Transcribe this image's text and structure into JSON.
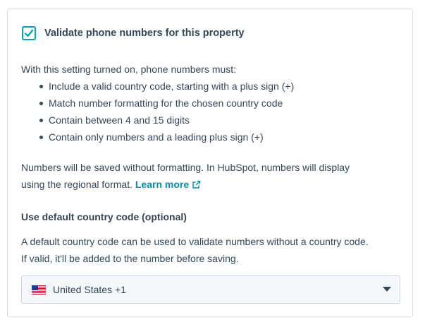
{
  "validation": {
    "checkbox_label": "Validate phone numbers for this property",
    "checked": true,
    "intro": "With this setting turned on, phone numbers must:",
    "rules": [
      "Include a valid country code, starting with a plus sign (+)",
      "Match number formatting for the chosen country code",
      "Contain between 4 and 15 digits",
      "Contain only numbers and a leading plus sign (+)"
    ],
    "note_line1": "Numbers will be saved without formatting. In HubSpot, numbers will display",
    "note_line2": "using the regional format.",
    "learn_more": "Learn more",
    "learn_more_icon": "external-link-icon"
  },
  "default_country": {
    "title": "Use default country code (optional)",
    "description_line1": "A default country code can be used to validate numbers without a country code.",
    "description_line2": "If valid, it'll be added to the number before saving.",
    "selected_value": "United States +1",
    "flag_icon": "us-flag-icon",
    "dropdown_icon": "caret-down-icon"
  },
  "colors": {
    "text": "#33475b",
    "accent": "#00a4bd",
    "link": "#0091ae",
    "border": "#d6dee6",
    "select_bg": "#f5f8fa"
  }
}
